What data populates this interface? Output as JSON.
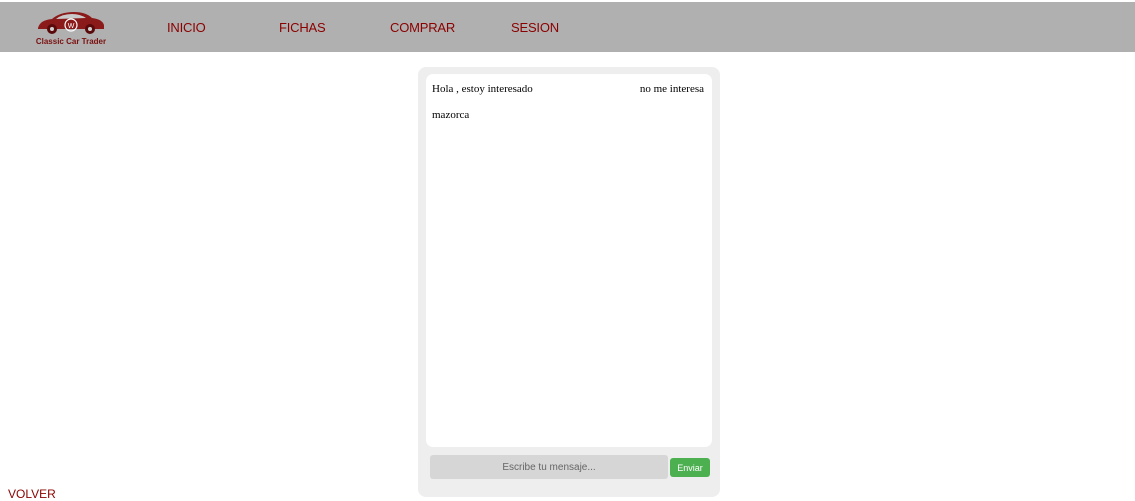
{
  "brand": {
    "name": "Classic Car Trader",
    "logo_icon": "classic-car-icon",
    "color": "#8b0000"
  },
  "nav": [
    {
      "label": "INICIO"
    },
    {
      "label": "FICHAS"
    },
    {
      "label": "COMPRAR"
    },
    {
      "label": "SESION"
    }
  ],
  "chat": {
    "messages": [
      {
        "text": "Hola , estoy interesado",
        "side": "left"
      },
      {
        "text": "no me interesa",
        "side": "right"
      },
      {
        "text": "mazorca",
        "side": "left"
      }
    ],
    "input": {
      "placeholder": "Escribe tu mensaje...",
      "value": ""
    },
    "send_label": "Enviar",
    "send_color": "#4caf50"
  },
  "footer": {
    "back_label": "VOLVER"
  }
}
